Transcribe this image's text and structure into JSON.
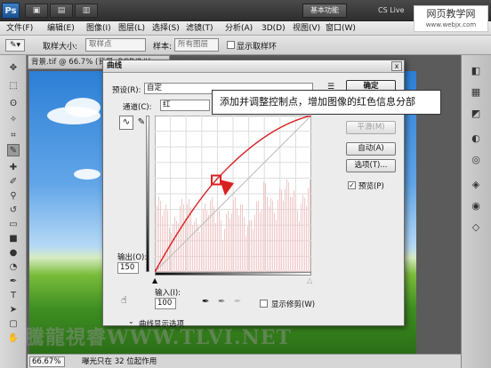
{
  "app": {
    "logo": "Ps",
    "workspace_label": "基本功能",
    "cslive_label": "CS Live",
    "top_buttons": [
      "▣",
      "▤",
      "▥"
    ]
  },
  "menu": [
    "文件(F)",
    "编辑(E)",
    "图像(I)",
    "图层(L)",
    "选择(S)",
    "滤镜(T)",
    "分析(A)",
    "3D(D)",
    "视图(V)",
    "窗口(W)"
  ],
  "options": {
    "sample_size_label": "取样大小:",
    "sample_size_value": "取样点",
    "sample_label": "样本:",
    "sample_value": "所有图层",
    "show_ring_label": "显示取样环"
  },
  "document": {
    "tab_title": "背景.tif @ 66.7% (背景, RGB/8#)",
    "zoom": "66.67%",
    "status": "曝光只在 32 位起作用"
  },
  "dialog": {
    "title": "曲线",
    "close": "x",
    "preset_label": "预设(R):",
    "preset_value": "自定",
    "channel_label": "通道(C):",
    "channel_value": "红",
    "output_label": "输出(O):",
    "output_value": "150",
    "input_label": "输入(I):",
    "input_value": "100",
    "show_clipping_label": "显示修剪(W)",
    "display_options_label": "曲线显示选项",
    "buttons": {
      "ok": "确定",
      "cancel": "取消",
      "smooth": "平滑(M)",
      "auto": "自动(A)",
      "options": "选项(T)...",
      "preview": "预览(P)"
    }
  },
  "callout": {
    "text": "添加并调整控制点，增加图像的红色信息分部"
  },
  "site_logo": {
    "main": "网页教学网",
    "sub": "www.webjx.com"
  },
  "watermark": "騰龍視睿WWW.TLVI.NET",
  "colors": {
    "curve": "#d92020",
    "accent": "#1b4f8e"
  }
}
